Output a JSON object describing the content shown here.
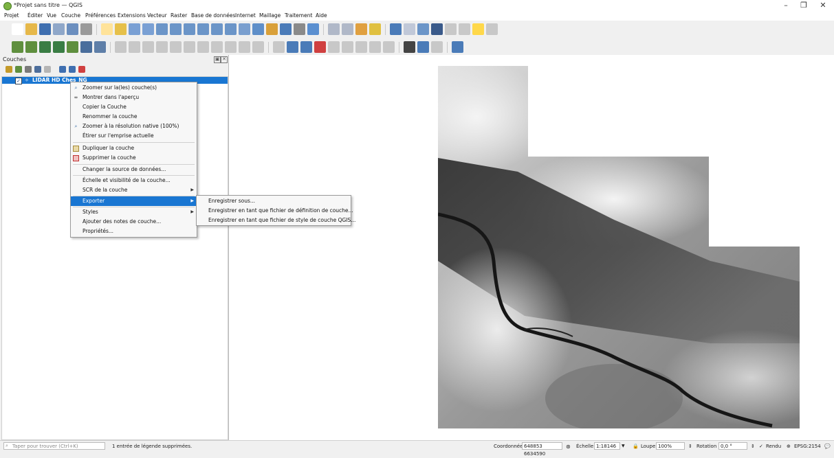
{
  "window": {
    "title": "*Projet sans titre — QGIS",
    "minimize": "–",
    "maximize": "❐",
    "close": "✕"
  },
  "menubar": [
    {
      "id": "projet",
      "label": "Projet"
    },
    {
      "id": "editer",
      "label": "Éditer"
    },
    {
      "id": "vue",
      "label": "Vue"
    },
    {
      "id": "couche",
      "label": "Couche"
    },
    {
      "id": "preferences",
      "label": "Préférences"
    },
    {
      "id": "extensions",
      "label": "Extensions"
    },
    {
      "id": "vecteur",
      "label": "Vecteur"
    },
    {
      "id": "raster",
      "label": "Raster"
    },
    {
      "id": "bdd",
      "label": "Base de données"
    },
    {
      "id": "internet",
      "label": "Internet"
    },
    {
      "id": "maillage",
      "label": "Maillage"
    },
    {
      "id": "traitement",
      "label": "Traitement"
    },
    {
      "id": "aide",
      "label": "Aide"
    }
  ],
  "layers_panel": {
    "title": "Couches",
    "close": "✕",
    "float": "▣"
  },
  "layers": [
    {
      "name": "LIDAR HD Ches_NG",
      "checked": "✓"
    }
  ],
  "context_menu": [
    {
      "id": "zoom-layer",
      "label": "Zoomer sur la(les) couche(s)",
      "icon": "zoom-icon"
    },
    {
      "id": "show-overview",
      "label": "Montrer dans l'aperçu",
      "icon": "glasses-icon"
    },
    {
      "id": "copy-layer",
      "label": "Copier la Couche"
    },
    {
      "id": "rename-layer",
      "label": "Renommer la couche"
    },
    {
      "id": "zoom-native",
      "label": "Zoomer à la résolution native (100%)",
      "icon": "zoom-native-icon"
    },
    {
      "id": "stretch-extent",
      "label": "Étirer sur l'emprise actuelle"
    },
    {
      "id": "duplicate-layer",
      "label": "Dupliquer la couche",
      "icon": "duplicate-icon"
    },
    {
      "id": "remove-layer",
      "label": "Supprimer la couche",
      "icon": "remove-icon"
    },
    {
      "id": "change-source",
      "label": "Changer la source de données..."
    },
    {
      "id": "scale-visibility",
      "label": "Échelle et visibilité de la couche..."
    },
    {
      "id": "layer-crs",
      "label": "SCR de la couche"
    },
    {
      "id": "export",
      "label": "Exporter"
    },
    {
      "id": "styles",
      "label": "Styles"
    },
    {
      "id": "add-notes",
      "label": "Ajouter des notes de couche..."
    },
    {
      "id": "properties",
      "label": "Propriétés..."
    }
  ],
  "export_submenu": [
    {
      "id": "save-as",
      "label": "Enregistrer sous..."
    },
    {
      "id": "save-definition",
      "label": "Enregistrer en tant que fichier de définition de couche..."
    },
    {
      "id": "save-style",
      "label": "Enregistrer en tant que fichier de style de couche QGIS..."
    }
  ],
  "statusbar": {
    "search_placeholder": "Taper pour trouver (Ctrl+K)",
    "message": "1 entrée de légende supprimées.",
    "coord_label": "Coordonnée",
    "coord_value": "648853 6634590",
    "scale_label": "Échelle",
    "scale_value": "1:18146",
    "magnifier_label": "Loupe",
    "magnifier_value": "100%",
    "rotation_label": "Rotation",
    "rotation_value": "0,0 °",
    "render_label": "Rendu",
    "render_checked": "✓",
    "crs_label": "EPSG:2154"
  }
}
